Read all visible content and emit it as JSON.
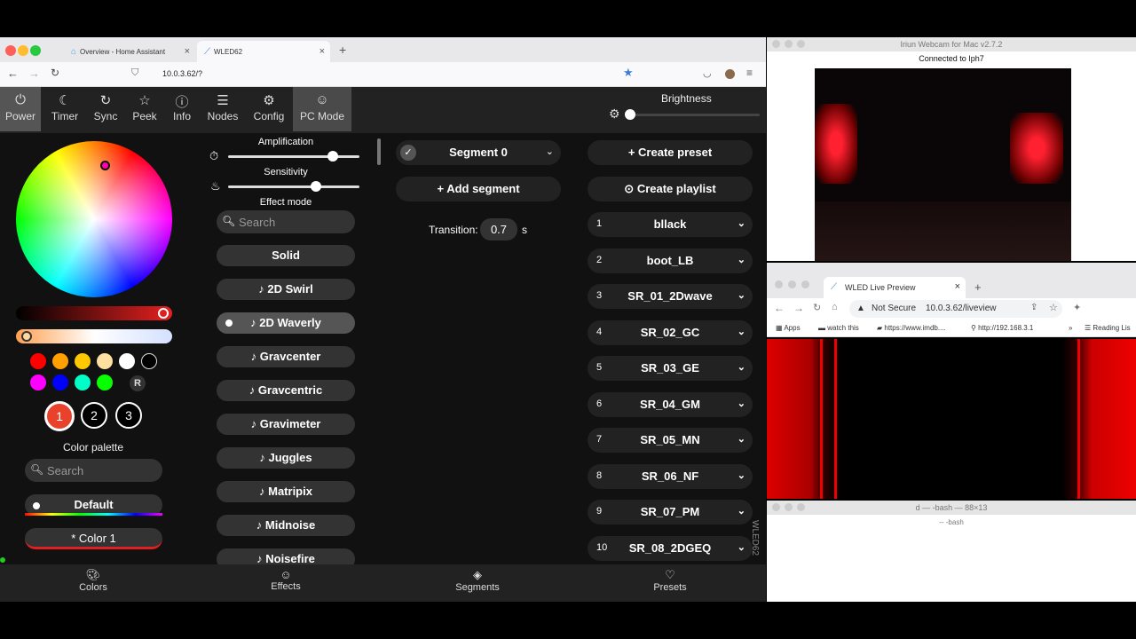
{
  "browser": {
    "tabs": [
      {
        "label": "Overview - Home Assistant"
      },
      {
        "label": "WLED62"
      }
    ],
    "url": "10.0.3.62/?"
  },
  "nav": {
    "items": [
      "Power",
      "Timer",
      "Sync",
      "Peek",
      "Info",
      "Nodes",
      "Config",
      "PC Mode"
    ],
    "brightness_label": "Brightness",
    "brightness": 0
  },
  "colors": {
    "swatches": [
      "#ff0000",
      "#ffa000",
      "#ffc800",
      "#ffe0a0",
      "#ffffff",
      "#000000",
      "#ff00ff",
      "#0000ff",
      "#00ffc8",
      "#08ff00"
    ],
    "random": "R",
    "slots": [
      "1",
      "2",
      "3"
    ],
    "palette_label": "Color palette",
    "search_placeholder": "Search",
    "palettes": [
      "Default",
      "* Color 1"
    ]
  },
  "effects": {
    "amplification_label": "Amplification",
    "amplification": 0.8,
    "sensitivity_label": "Sensitivity",
    "sensitivity": 0.67,
    "mode_label": "Effect mode",
    "search_placeholder": "Search",
    "list": [
      "Solid",
      "♪ 2D Swirl",
      "♪ 2D Waverly",
      "♪ Gravcenter",
      "♪ Gravcentric",
      "♪ Gravimeter",
      "♪ Juggles",
      "♪ Matripix",
      "♪ Midnoise",
      "♪ Noisefire"
    ],
    "selected": "♪ 2D Waverly"
  },
  "segments": {
    "segment_label": "Segment 0",
    "add_label": "Add segment",
    "transition_label": "Transition:",
    "transition_value": "0.7",
    "transition_unit": "s"
  },
  "presets": {
    "create_preset": "Create preset",
    "create_playlist": "Create playlist",
    "list": [
      {
        "id": "1",
        "name": "bllack"
      },
      {
        "id": "2",
        "name": "boot_LB"
      },
      {
        "id": "3",
        "name": "SR_01_2Dwave"
      },
      {
        "id": "4",
        "name": "SR_02_GC"
      },
      {
        "id": "5",
        "name": "SR_03_GE"
      },
      {
        "id": "6",
        "name": "SR_04_GM"
      },
      {
        "id": "7",
        "name": "SR_05_MN"
      },
      {
        "id": "8",
        "name": "SR_06_NF"
      },
      {
        "id": "9",
        "name": "SR_07_PM"
      },
      {
        "id": "10",
        "name": "SR_08_2DGEQ"
      }
    ],
    "vertical_label": "WLED62"
  },
  "bottom_nav": [
    "Colors",
    "Effects",
    "Segments",
    "Presets"
  ],
  "webcam": {
    "title": "Iriun Webcam for Mac v2.7.2",
    "status": "Connected to Iph7"
  },
  "live": {
    "tab": "WLED Live Preview",
    "security": "Not Secure",
    "url": "10.0.3.62/liveview",
    "bookmarks": [
      "Apps",
      "watch this",
      "https://www.imdb....",
      "http://192.168.3.1",
      "Reading Lis"
    ]
  },
  "terminal": {
    "title": "d — -bash — 88×13",
    "subtitle": "-- -bash"
  },
  "accent": "#3d7bd6"
}
